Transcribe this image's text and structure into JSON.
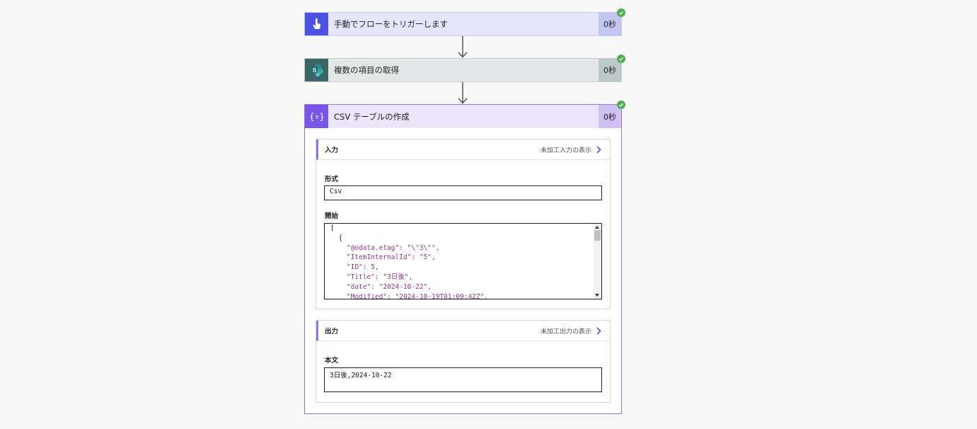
{
  "steps": [
    {
      "title": "手動でフローをトリガーします",
      "duration": "0秒",
      "icon": "hand-touch-icon"
    },
    {
      "title": "複数の項目の取得",
      "duration": "0秒",
      "icon": "sharepoint-icon"
    },
    {
      "title": "CSV テーブルの作成",
      "duration": "0秒",
      "icon": "data-operation-icon"
    }
  ],
  "inputs": {
    "label": "入力",
    "raw_link": "未加工入力の表示",
    "format_label": "形式",
    "format_value": "Csv",
    "from_label": "開始",
    "from_lines": [
      "[",
      "  {",
      "    \"@odata.etag\": \"\\\"3\\\"\",",
      "    \"ItemInternalId\": \"5\",",
      "    \"ID\": 5,",
      "    \"Title\": \"3日後\",",
      "    \"date\": \"2024-10-22\",",
      "    \"Modified\": \"2024-10-19T01:09:42Z\","
    ]
  },
  "outputs": {
    "label": "出力",
    "raw_link": "未加工出力の表示",
    "body_label": "本文",
    "body_value": "3日後,2024-10-22"
  },
  "colors": {
    "trigger": "#4b53e0",
    "sharepoint": "#3a6666",
    "data_operation": "#7a56e6",
    "success": "#4caf50"
  }
}
